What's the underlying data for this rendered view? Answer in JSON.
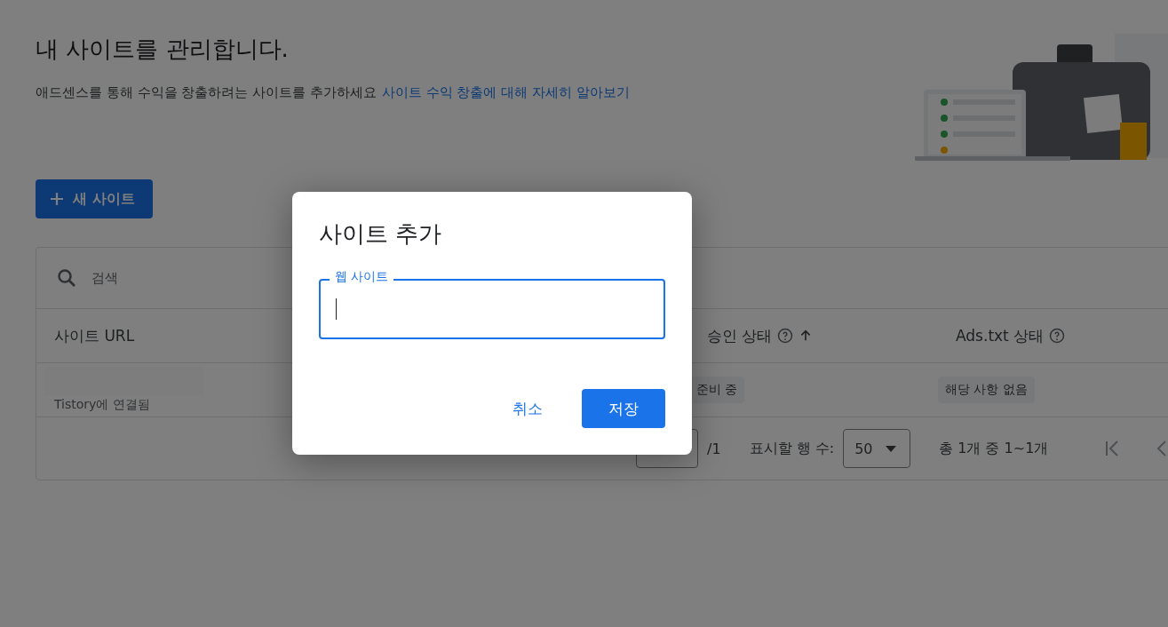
{
  "page": {
    "title": "내 사이트를 관리합니다.",
    "description": "애드센스를 통해 수익을 창출하려는 사이트를 추가하세요",
    "link": "사이트 수익 창출에 대해 자세히 알아보기"
  },
  "new_site_button": {
    "label": "새 사이트"
  },
  "table": {
    "search": {
      "placeholder": "검색"
    },
    "columns": [
      {
        "label": "사이트 URL",
        "help": false,
        "sorted": false
      },
      {
        "label": "승인 상태",
        "help": true,
        "sorted": true
      },
      {
        "label": "Ads.txt 상태",
        "help": true,
        "sorted": false
      }
    ],
    "rows": [
      {
        "site_note": "Tistory에 연결됨",
        "status": "준비 중",
        "ads_txt": "해당 사항 없음"
      }
    ],
    "pagination": {
      "page_total": "/1",
      "rows_label": "표시할 행 수:",
      "rows_value": "50",
      "range": "총 1개 중 1~1개"
    }
  },
  "dialog": {
    "title": "사이트 추가",
    "field": {
      "label": "웹 사이트",
      "focused": true
    },
    "buttons": [
      {
        "label": "취소",
        "kind": "text"
      },
      {
        "label": "저장",
        "kind": "filled"
      }
    ]
  }
}
